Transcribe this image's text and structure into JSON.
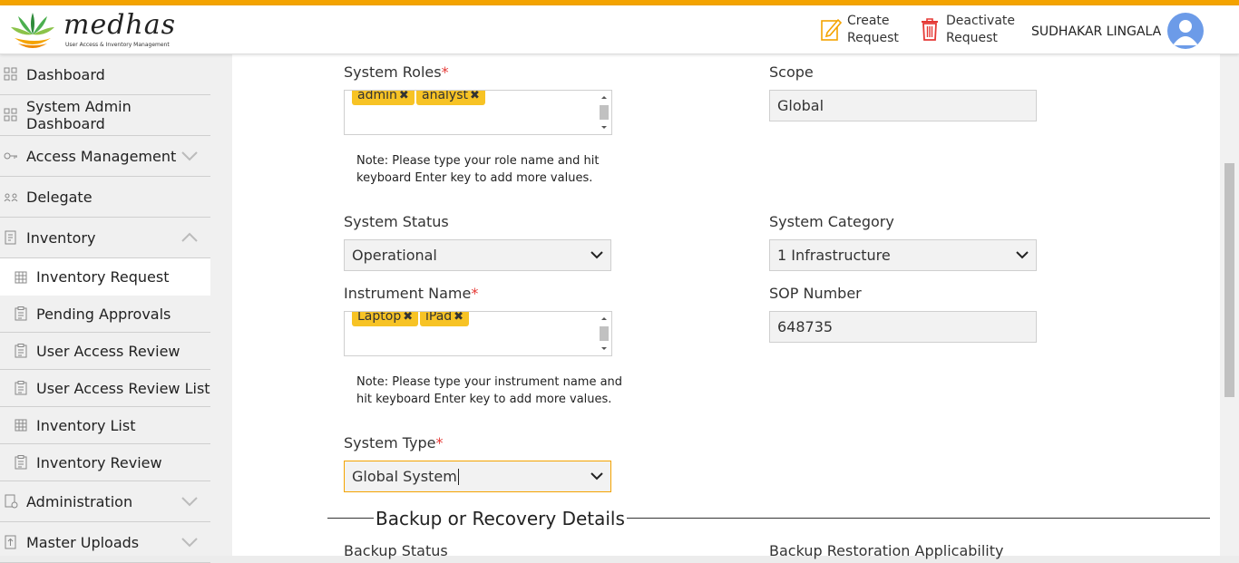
{
  "brand": {
    "name": "medhas",
    "tagline": "User Access & Inventory Management"
  },
  "header": {
    "create_label_1": "Create",
    "create_label_2": "Request",
    "deactivate_label_1": "Deactivate",
    "deactivate_label_2": "Request",
    "user_name": "SUDHAKAR LINGALA"
  },
  "sidebar": {
    "dashboard": "Dashboard",
    "system_admin_dashboard": "System Admin Dashboard",
    "access_management": "Access Management",
    "delegate": "Delegate",
    "inventory": "Inventory",
    "inventory_request": "Inventory Request",
    "pending_approvals": "Pending Approvals",
    "user_access_review": "User Access Review",
    "user_access_review_list": "User Access Review List",
    "inventory_list": "Inventory List",
    "inventory_review": "Inventory Review",
    "administration": "Administration",
    "master_uploads": "Master Uploads"
  },
  "form": {
    "system_roles_label": "System Roles",
    "system_roles_tags": [
      "admin",
      "analyst"
    ],
    "system_roles_note": "Note: Please type your role name and hit keyboard Enter key to add more values.",
    "scope_label": "Scope",
    "scope_value": "Global",
    "system_status_label": "System Status",
    "system_status_value": "Operational",
    "system_category_label": "System Category",
    "system_category_value": "1 Infrastructure",
    "instrument_name_label": "Instrument Name",
    "instrument_tags": [
      "Laptop",
      "iPad"
    ],
    "instrument_note": "Note: Please type your instrument name and hit keyboard Enter key to add more values.",
    "sop_number_label": "SOP Number",
    "sop_number_value": "648735",
    "system_type_label": "System Type",
    "system_type_value": "Global System",
    "required_mark": "*",
    "tag_remove": "✖"
  },
  "section": {
    "backup_title": "Backup or Recovery Details",
    "backup_status_label": "Backup Status",
    "backup_restoration_label": "Backup Restoration Applicability"
  },
  "colors": {
    "accent": "#f4a300",
    "tag": "#f7c325",
    "required": "#e53935"
  }
}
